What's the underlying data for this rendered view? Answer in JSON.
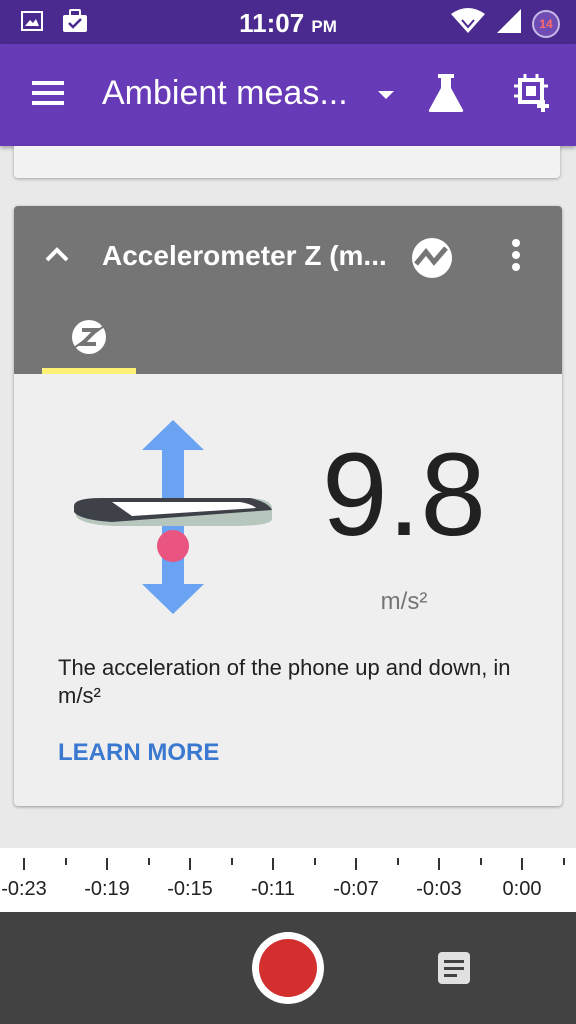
{
  "status_bar": {
    "time": "11:07",
    "ampm": "PM",
    "notification_count": "14",
    "icons": [
      "image-icon",
      "briefcase-check-icon",
      "wifi-icon",
      "signal-icon"
    ]
  },
  "app_bar": {
    "title": "Ambient meas...",
    "icons": [
      "menu-icon",
      "dropdown-arrow-icon",
      "flask-icon",
      "add-sensor-icon"
    ],
    "color": "#673ab7"
  },
  "sensor_card": {
    "title": "Accelerometer Z (m...",
    "value": "9.8",
    "unit": "m/s²",
    "description": "The acceleration of the phone up and down, in m/s²",
    "learn_more": "LEARN MORE",
    "header_color": "#757575",
    "tab_indicator_color": "#fff176",
    "link_color": "#3b78d0"
  },
  "timeline": {
    "labels": [
      "-0:23",
      "-0:19",
      "-0:15",
      "-0:11",
      "-0:07",
      "-0:03",
      "0:00"
    ]
  },
  "bottom_bar": {
    "record_color": "#d32f2f",
    "icons": [
      "record-icon",
      "note-icon"
    ]
  }
}
